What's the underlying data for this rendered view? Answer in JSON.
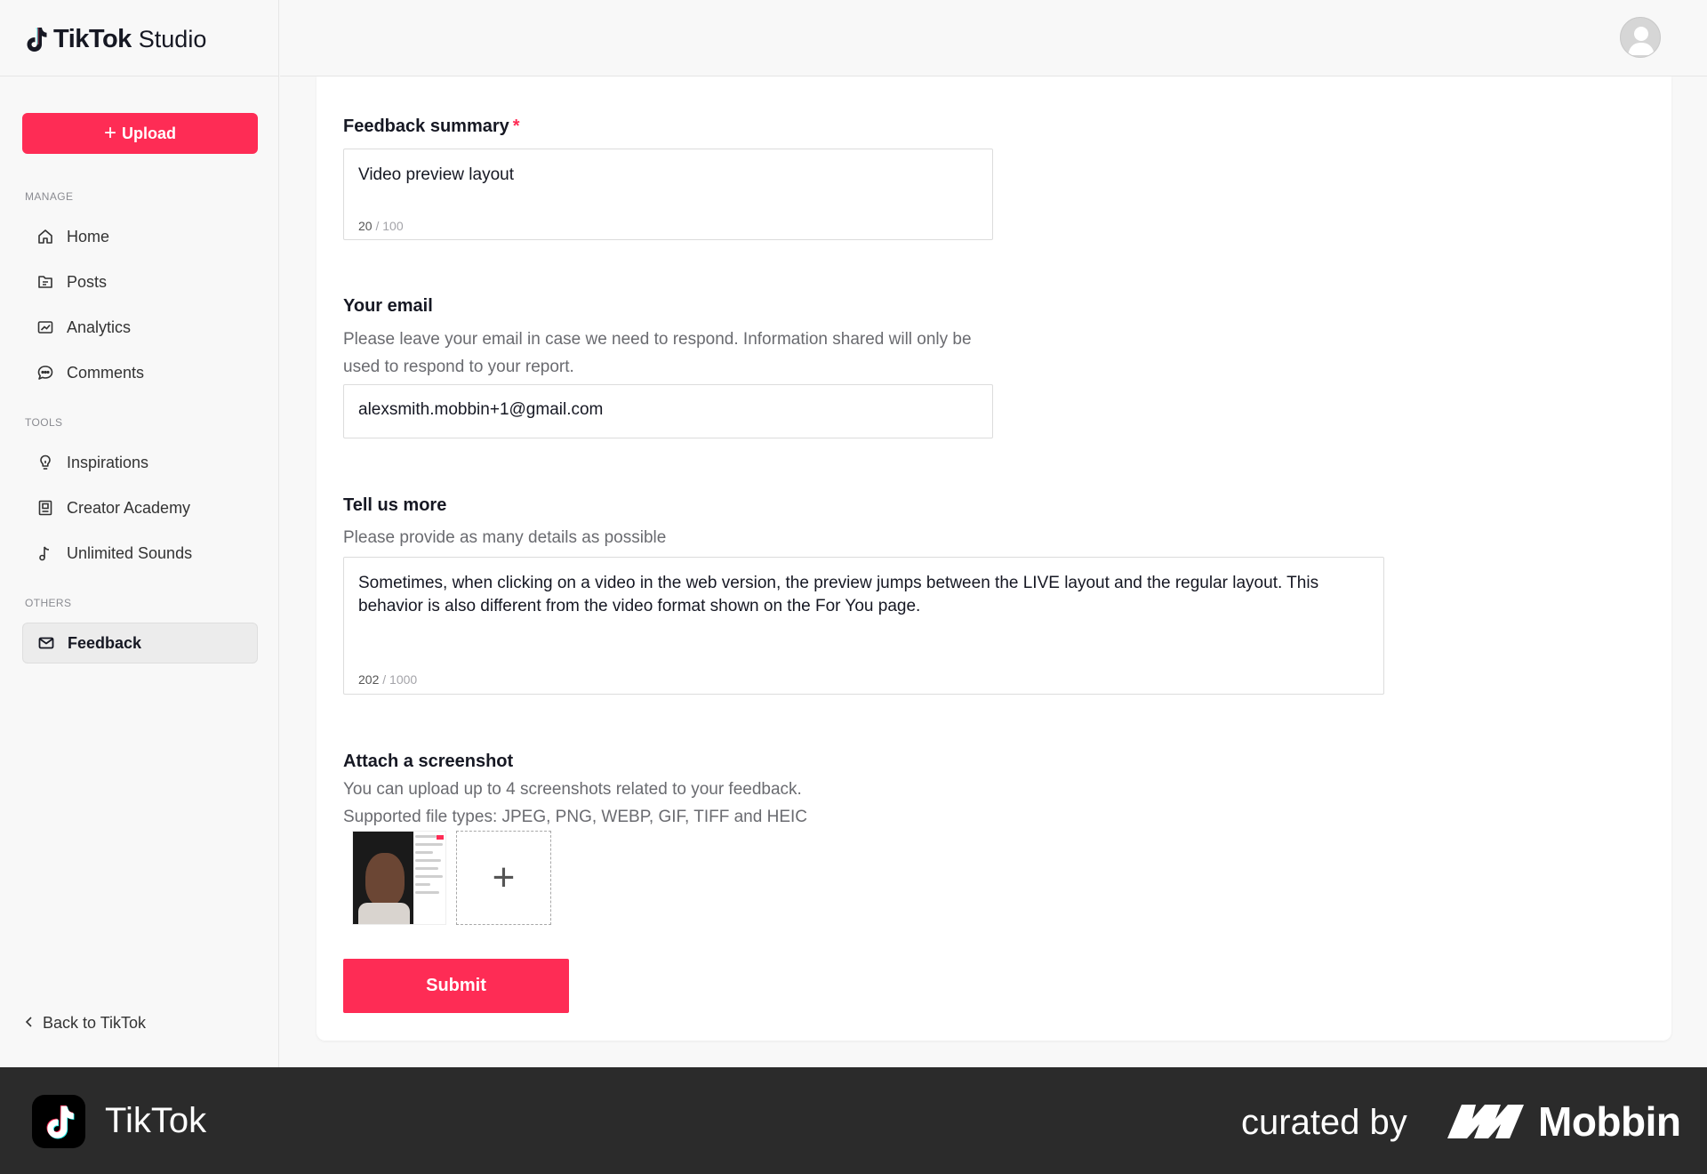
{
  "app": {
    "brand": "TikTok",
    "brand_sub": "Studio"
  },
  "sidebar": {
    "upload_label": "Upload",
    "sections": {
      "manage": "MANAGE",
      "tools": "TOOLS",
      "others": "OTHERS"
    },
    "items": [
      {
        "label": "Home",
        "icon": "home-icon"
      },
      {
        "label": "Posts",
        "icon": "posts-icon"
      },
      {
        "label": "Analytics",
        "icon": "analytics-icon"
      },
      {
        "label": "Comments",
        "icon": "comments-icon"
      },
      {
        "label": "Inspirations",
        "icon": "lightbulb-icon"
      },
      {
        "label": "Creator Academy",
        "icon": "academy-icon"
      },
      {
        "label": "Unlimited Sounds",
        "icon": "music-note-icon"
      },
      {
        "label": "Feedback",
        "icon": "mail-icon",
        "active": true
      }
    ],
    "back_label": "Back to TikTok"
  },
  "form": {
    "summary": {
      "label": "Feedback summary",
      "required_mark": "*",
      "value": "Video preview layout",
      "count": "20",
      "max": "/ 100"
    },
    "email": {
      "label": "Your email",
      "description": "Please leave your email in case we need to respond. Information shared will only be used to respond to your report.",
      "value": "alexsmith.mobbin+1@gmail.com"
    },
    "details": {
      "label": "Tell us more",
      "description": "Please provide as many details as possible",
      "value": "Sometimes, when clicking on a video in the web version, the preview jumps between the LIVE layout and the regular layout. This behavior is also different from the video format shown on the For You page.",
      "count": "202",
      "max": "/ 1000"
    },
    "screenshot": {
      "label": "Attach a screenshot",
      "description_line1": "You can upload up to 4 screenshots related to your feedback.",
      "description_line2": "Supported file types: JPEG, PNG, WEBP, GIF, TIFF and HEIC",
      "add_symbol": "+"
    },
    "submit_label": "Submit"
  },
  "footer": {
    "app_name": "TikTok",
    "curated_by": "curated by",
    "mobbin": "Mobbin"
  },
  "colors": {
    "accent": "#fe2c55",
    "footer_bg": "#2b2b2b"
  }
}
